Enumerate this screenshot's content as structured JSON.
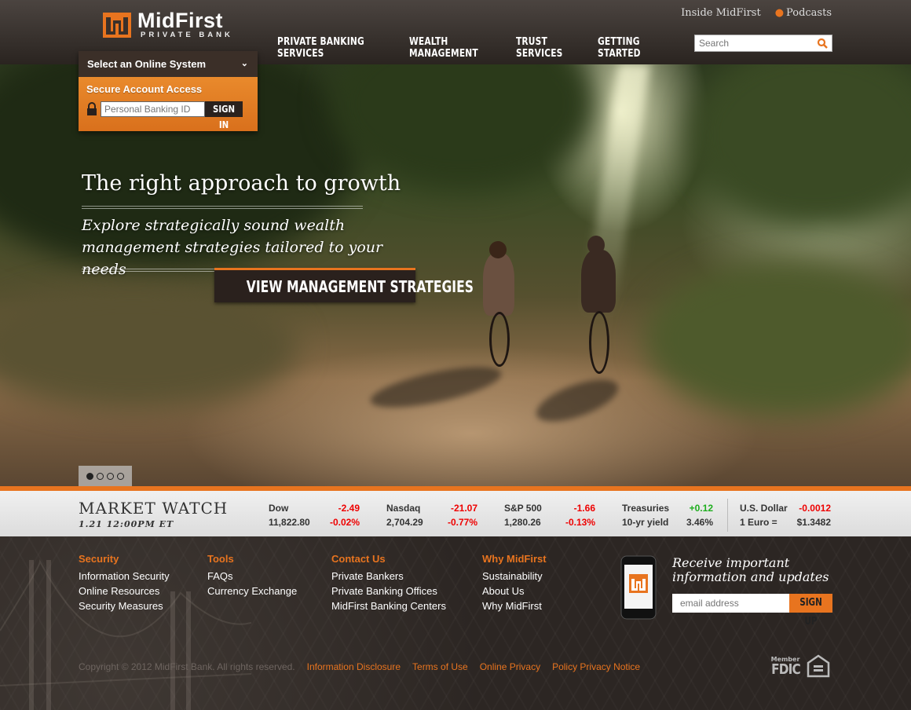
{
  "header": {
    "logo_name": "MidFirst",
    "logo_sub": "PRIVATE BANK",
    "util_links": [
      "Inside MidFirst",
      "Podcasts"
    ],
    "nav": [
      "PRIVATE BANKING SERVICES",
      "WEALTH MANAGEMENT",
      "TRUST SERVICES",
      "GETTING STARTED"
    ],
    "search_placeholder": "Search"
  },
  "login": {
    "select_label": "Select an Online System",
    "title": "Secure Account Access",
    "id_placeholder": "Personal Banking ID",
    "signin_label": "SIGN IN"
  },
  "hero": {
    "title": "The right approach to growth",
    "subtitle": "Explore strategically sound wealth management strategies tailored to your needs",
    "cta": "VIEW MANAGEMENT STRATEGIES",
    "slide_count": 4,
    "active_slide": 1
  },
  "market": {
    "title": "MARKET WATCH",
    "date": "1.21 12:00PM ET",
    "tickers": [
      {
        "name": "Dow",
        "change": "-2.49",
        "value": "11,822.80",
        "pct": "-0.02%",
        "dir": "down"
      },
      {
        "name": "Nasdaq",
        "change": "-21.07",
        "value": "2,704.29",
        "pct": "-0.77%",
        "dir": "down"
      },
      {
        "name": "S&P 500",
        "change": "-1.66",
        "value": "1,280.26",
        "pct": "-0.13%",
        "dir": "down"
      },
      {
        "name": "Treasuries",
        "change": "+0.12",
        "value": "10-yr yield",
        "pct": "3.46%",
        "dir": "up"
      },
      {
        "name": "U.S. Dollar",
        "change": "-0.0012",
        "value": "1 Euro =",
        "pct": "$1.3482",
        "dir": "down"
      }
    ]
  },
  "footer": {
    "columns": [
      {
        "heading": "Security",
        "links": [
          "Information Security",
          "Online Resources",
          "Security Measures"
        ]
      },
      {
        "heading": "Tools",
        "links": [
          "FAQs",
          "Currency Exchange"
        ]
      },
      {
        "heading": "Contact Us",
        "links": [
          "Private Bankers",
          "Private Banking Offices",
          "MidFirst Banking Centers"
        ]
      },
      {
        "heading": "Why MidFirst",
        "links": [
          "Sustainability",
          "About Us",
          "Why MidFirst"
        ]
      }
    ],
    "newsletter_title_1": "Receive important",
    "newsletter_title_2": "information and updates",
    "email_placeholder": "email address",
    "signup_label": "SIGN UP",
    "copyright": "Copyright © 2012 MidFirst Bank. All rights reserved.",
    "legal_links": [
      "Information Disclosure",
      "Terms of Use",
      "Online Privacy",
      "Policy Privacy Notice"
    ],
    "fdic_member": "Member",
    "fdic": "FDIC"
  },
  "colors": {
    "accent": "#e8741f",
    "dark": "#2a211d",
    "down": "#e00000",
    "up": "#1eae1e"
  }
}
